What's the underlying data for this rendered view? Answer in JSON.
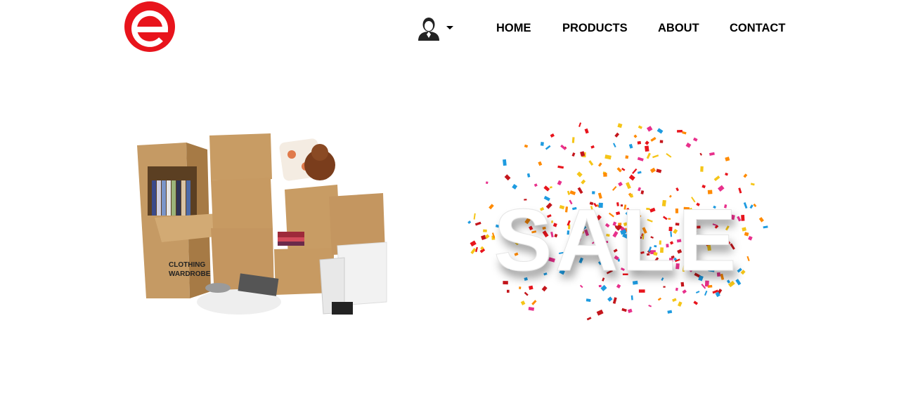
{
  "header": {
    "logo_icon": "brand-logo-e-icon",
    "brand_color": "#e8141c",
    "user_icon": "user-avatar-icon",
    "dropdown_icon": "caret-down-icon"
  },
  "nav": {
    "items": [
      {
        "label": "HOME"
      },
      {
        "label": "PRODUCTS"
      },
      {
        "label": "ABOUT"
      },
      {
        "label": "CONTACT"
      }
    ]
  },
  "hero": {
    "left_image": "moving-boxes-image",
    "right_image": "sale-confetti-image",
    "sale_text": "SALE"
  }
}
